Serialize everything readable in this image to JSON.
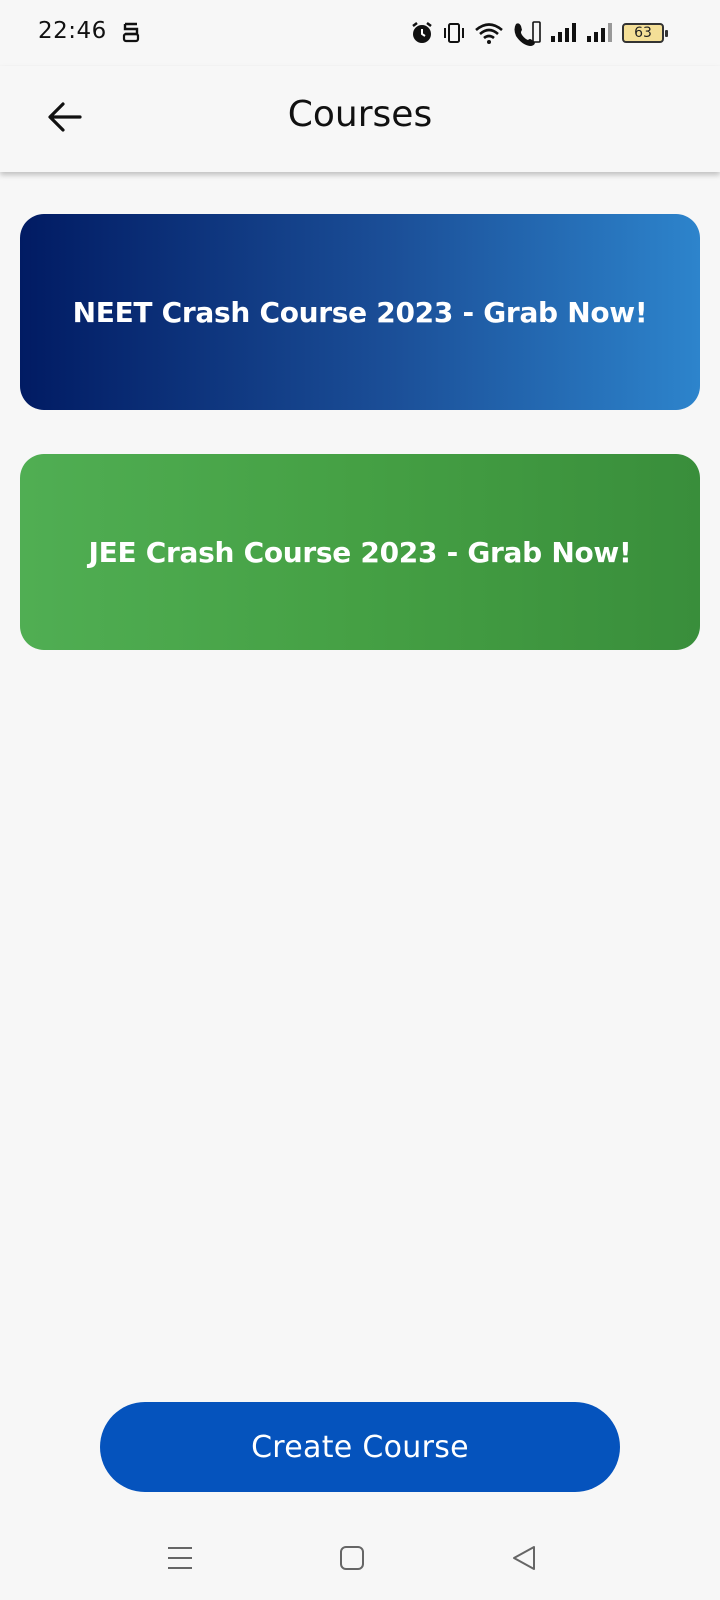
{
  "status_bar": {
    "time": "22:46",
    "battery": "63",
    "icons": [
      "sim-icon",
      "alarm-icon",
      "vibrate-icon",
      "wifi-icon",
      "volte-call-icon",
      "signal-1-icon",
      "signal-2-icon",
      "battery-icon"
    ]
  },
  "app_bar": {
    "title": "Courses",
    "back_icon": "arrow-left-icon"
  },
  "courses": [
    {
      "label": "NEET Crash Course 2023 - Grab Now!",
      "gradient": [
        "#011b63",
        "#2d84cc"
      ]
    },
    {
      "label": "JEE Crash Course 2023 - Grab Now!",
      "gradient": [
        "#50ae53",
        "#398e3b"
      ]
    }
  ],
  "actions": {
    "create_label": "Create Course",
    "create_color": "#0553bd"
  },
  "nav_bar": {
    "icons": [
      "menu-icon",
      "home-icon",
      "back-triangle-icon"
    ]
  }
}
